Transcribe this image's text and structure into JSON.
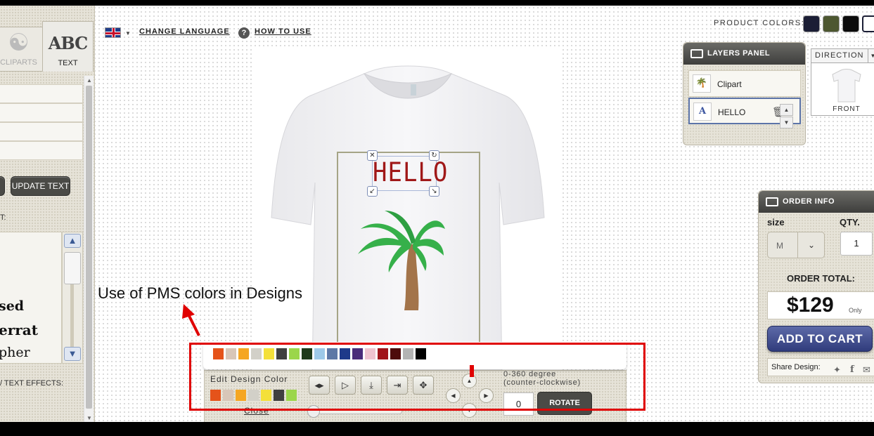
{
  "top_bar": {
    "change_language": "CHANGE LANGUAGE",
    "how_to_use": "HOW TO USE",
    "help_glyph": "?",
    "product_colors_label": "PRODUCT COLORS:",
    "product_colors": [
      "#1b1e35",
      "#4d5730",
      "#0b0b0b",
      "#ffffff"
    ]
  },
  "sidebar": {
    "tabs": [
      {
        "label": "CLIPARTS",
        "icon": "ant-mascot-icon"
      },
      {
        "label": "TEXT",
        "icon_text": "ABC"
      }
    ],
    "update_text_button": "UPDATE TEXT",
    "font_section_label": "T:",
    "fonts": [
      "sed",
      "errat",
      "pher"
    ],
    "effects_label": "/ TEXT EFFECTS:"
  },
  "canvas": {
    "design_text": "HELLO",
    "text_color": "#a01818",
    "clipart": "palm-tree",
    "annotation": "Use of PMS colors in Designs"
  },
  "layers_panel": {
    "title": "LAYERS PANEL",
    "layers": [
      {
        "name": "Clipart",
        "icon": "palm-tree-icon"
      },
      {
        "name": "HELLO",
        "icon_text": "A",
        "selected": true
      }
    ]
  },
  "direction": {
    "label": "DIRECTION",
    "view": "FRONT"
  },
  "order_info": {
    "title": "ORDER INFO",
    "size_label": "size",
    "size_value": "M",
    "qty_label": "QTY.",
    "qty_value": "1",
    "total_label": "ORDER TOTAL:",
    "price": "$129",
    "price_suffix": "Only",
    "add_to_cart": "ADD TO CART",
    "share_label": "Share Design:"
  },
  "color_tool": {
    "pms_palette": [
      "#e5531a",
      "#d8c6b8",
      "#f5a623",
      "#d2d0c8",
      "#f4e03a",
      "#404040",
      "#9bd64a",
      "#1f3a1b",
      "#9ec9e8",
      "#5e78a6",
      "#1e3a8a",
      "#4a2c7a",
      "#efc4d0",
      "#a0151b",
      "#4e0b0b",
      "#b3b3b3",
      "#000000"
    ],
    "edit_label": "Edit Design Color",
    "design_colors": [
      "#e5531a",
      "#d8c6b8",
      "#f5a623",
      "#d2d0c8",
      "#f4e03a",
      "#404040",
      "#9bd64a"
    ],
    "close": "Close",
    "degree_label_1": "0-360 degree",
    "degree_label_2": "(counter-clockwise)",
    "degree_value": "0",
    "rotate": "ROTATE"
  }
}
